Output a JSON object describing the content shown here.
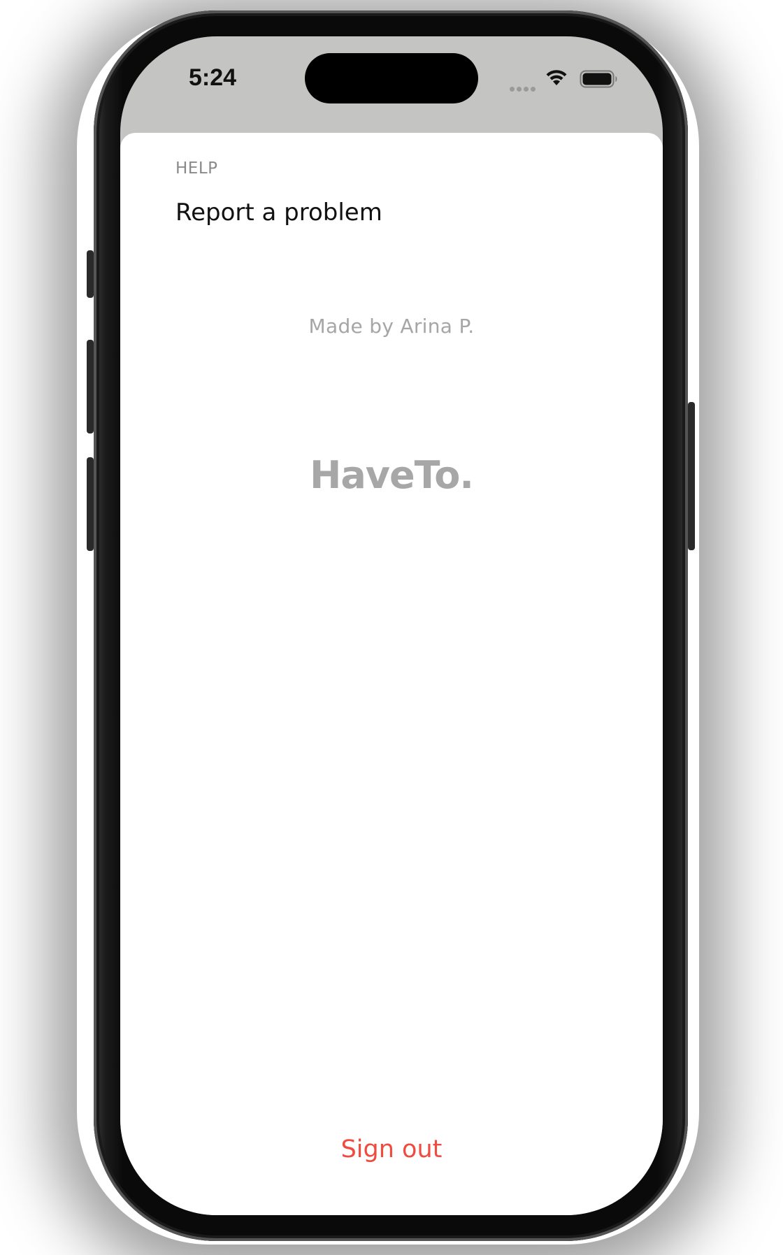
{
  "status_bar": {
    "time": "5:24",
    "icons": [
      "cellular-signal-icon",
      "wifi-icon",
      "battery-icon"
    ]
  },
  "settings": {
    "section_header": "HELP",
    "items": [
      {
        "label": "Report a problem"
      }
    ],
    "credit": "Made by Arina P.",
    "app_logo": "HaveTo.",
    "sign_out_label": "Sign out"
  },
  "colors": {
    "destructive": "#ef4b3f",
    "secondary_text": "#a6a6a6",
    "status_bar_bg": "#c4c4c2"
  }
}
